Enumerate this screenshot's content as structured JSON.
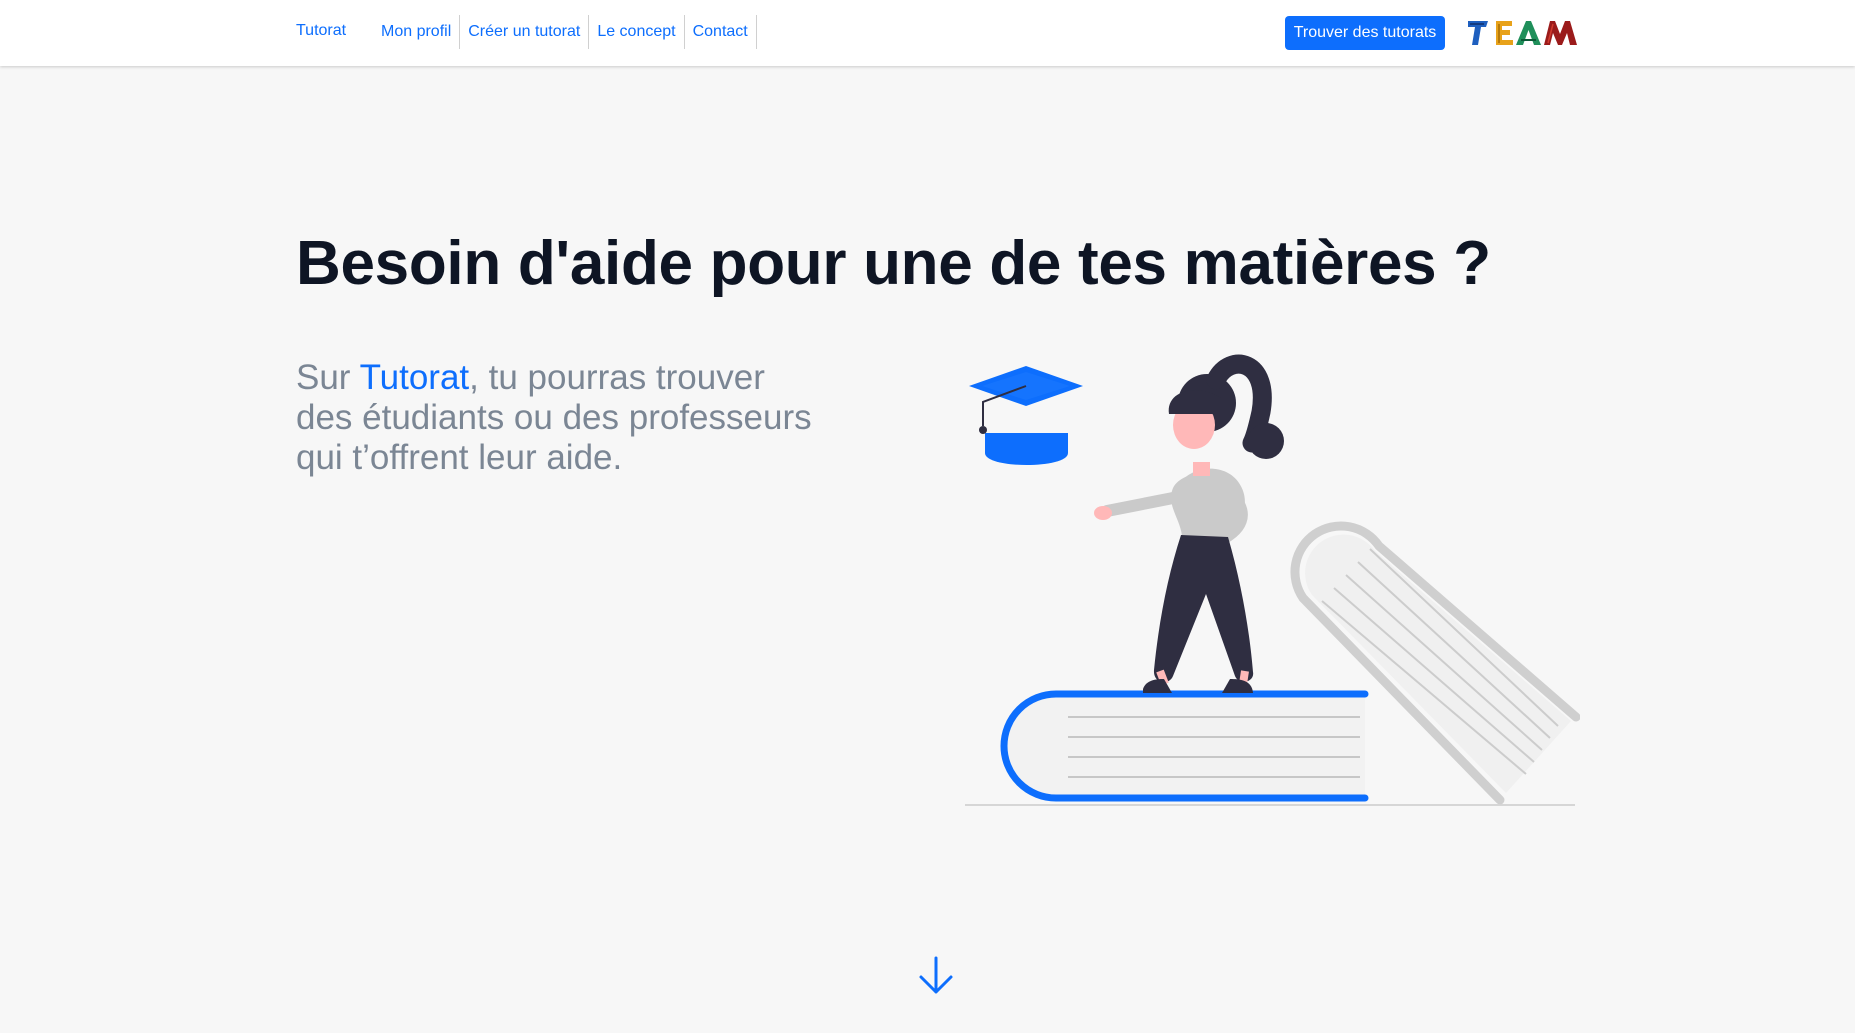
{
  "navbar": {
    "brand": "Tutorat",
    "links": [
      {
        "label": "Mon profil"
      },
      {
        "label": "Créer un tutorat"
      },
      {
        "label": "Le concept"
      },
      {
        "label": "Contact"
      }
    ],
    "cta_label": "Trouver des tutorats",
    "logo_text": "TEAM",
    "logo_colors": [
      "#1e5fbf",
      "#e8a21a",
      "#1f8f5a",
      "#9b1b1b"
    ]
  },
  "hero": {
    "title": "Besoin d'aide pour une de tes matières ?",
    "text_prefix": "Sur ",
    "text_highlight": "Tutorat",
    "text_suffix": ", tu pourras trouver des étudiants ou des professeurs qui t’offrent leur aide."
  },
  "colors": {
    "accent": "#0d6efd",
    "heading": "#0e1524",
    "muted_text": "#7b8694",
    "background": "#f7f7f7"
  },
  "icons": {
    "scroll": "arrow-down-icon",
    "illustration": "student-on-books-illustration"
  }
}
